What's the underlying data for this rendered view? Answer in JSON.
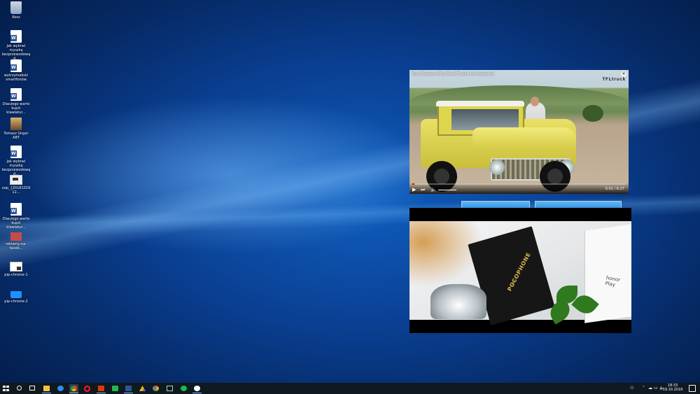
{
  "desktop": {
    "icons": [
      {
        "label": "Kosz",
        "kind": "recycle-bin"
      },
      {
        "label": "Jak wybrać myszkę bezprzewodową d...",
        "kind": "word-document"
      },
      {
        "label": "wytrzymałość smartfonów",
        "kind": "word-document"
      },
      {
        "label": "Dlaczego warto kupić klawiatur...",
        "kind": "word-document"
      },
      {
        "label": "Tomasz Unger ABT",
        "kind": "image-file"
      },
      {
        "label": "Jak wybrać myszkę bezprzewodową d...",
        "kind": "word-document"
      },
      {
        "label": "oop_{2018101912...",
        "kind": "shortcut"
      },
      {
        "label": "Dlaczego warto kupić klawiatur...",
        "kind": "word-document"
      },
      {
        "label": "reklamy-na-faceb...",
        "kind": "image-file"
      },
      {
        "label": "pip-chrome-1",
        "kind": "app-shortcut"
      },
      {
        "label": "pip-chrome-2",
        "kind": "app-shortcut"
      }
    ]
  },
  "pip_video_1": {
    "title": "Top 5 Reasons Why Small Trucks are Awesome!",
    "channel_logo": "TFLtruck",
    "time": "0:01 / 6:27",
    "progress": 0.003,
    "close_label": "×",
    "play_label": "▶",
    "next_label": "⏭",
    "volume_label": "🔈"
  },
  "pip_video_2": {
    "box_brand": "POCOPHONE",
    "box_subtitle": "by Xiaomi",
    "second_box_text": "honor Play"
  },
  "taskbar": {
    "apps": [
      "start-icon",
      "search-icon",
      "task-view-icon",
      "file-explorer-icon",
      "edge-icon",
      "chrome-icon",
      "opera-icon",
      "office-icon",
      "app-green-icon",
      "word-icon",
      "google-drive-icon",
      "photos-icon",
      "app-box-icon",
      "spotify-icon",
      "app-s-icon"
    ],
    "active_app": "chrome-icon",
    "clock_time": "18:33",
    "clock_date": "19.10.2018",
    "accent": "#7fb9ff"
  }
}
